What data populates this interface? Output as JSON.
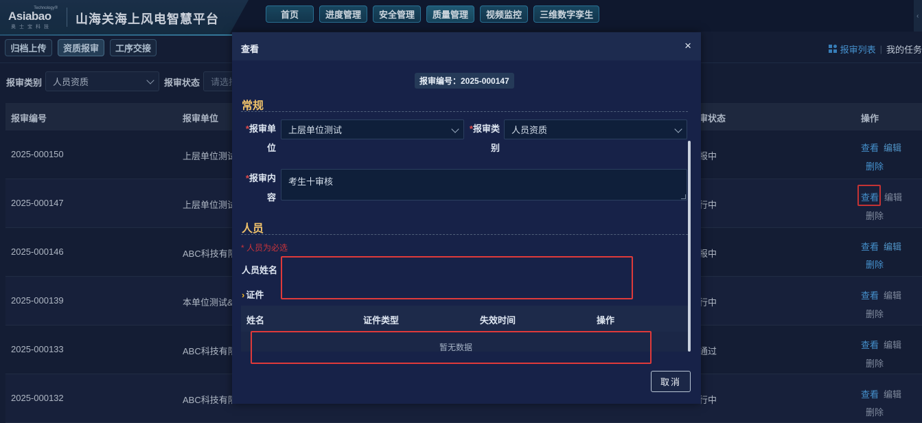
{
  "header": {
    "logo_tagline": "Technology®",
    "logo_text": "Asiabao",
    "logo_sub": "奥士宝科技",
    "app_title": "山海关海上风电智慧平台",
    "nav": [
      "首页",
      "进度管理",
      "安全管理",
      "质量管理",
      "视频监控",
      "三维数字孪生"
    ],
    "active_nav": "质量管理"
  },
  "subbar": {
    "buttons": [
      "归档上传",
      "资质报审",
      "工序交接"
    ],
    "active": "资质报审",
    "report_list": "报审列表",
    "separator": "|",
    "my_tasks": "我的任务"
  },
  "filter": {
    "category_label": "报审类别",
    "category_value": "人员资质",
    "status_label": "报审状态",
    "status_placeholder": "请选择"
  },
  "table": {
    "headers": {
      "code": "报审编号",
      "unit": "报审单位",
      "status": "审状态",
      "actions": "操作"
    },
    "rows": [
      {
        "code": "2025-000150",
        "unit": "上层单位测试",
        "status": "报中"
      },
      {
        "code": "2025-000147",
        "unit": "上层单位测试",
        "status": "行中"
      },
      {
        "code": "2025-000146",
        "unit": "ABC科技有限",
        "status": "报中"
      },
      {
        "code": "2025-000139",
        "unit": "本单位测试&a",
        "status": "行中"
      },
      {
        "code": "2025-000133",
        "unit": "ABC科技有限",
        "status": "通过"
      },
      {
        "code": "2025-000132",
        "unit": "ABC科技有限",
        "status": "行中"
      }
    ],
    "action_labels": {
      "view": "查看",
      "edit": "编辑",
      "delete": "删除"
    }
  },
  "modal": {
    "title": "查看",
    "close": "×",
    "code_pill": "报审编号：2025-000147",
    "section_general": "常规",
    "required_mark": "*",
    "unit_label_1": "报审单",
    "unit_label_2": "位",
    "unit_value": "上层单位测试",
    "category_label_1": "报审类",
    "category_label_2": "别",
    "category_value": "人员资质",
    "content_label_1": "报审内",
    "content_label_2": "容",
    "content_value": "考生十审核",
    "section_personnel": "人员",
    "required_hint": "* 人员为必选",
    "person_name_label": "人员姓名",
    "cert_label": "证件",
    "cert_table_headers": [
      "姓名",
      "证件类型",
      "失效时间",
      "操作"
    ],
    "empty_text": "暂无数据",
    "cancel": "取消"
  },
  "colors": {
    "accent": "#f0c26a",
    "link": "#4ea3e6",
    "danger": "#e03a3a",
    "modal_bg": "#172248"
  }
}
